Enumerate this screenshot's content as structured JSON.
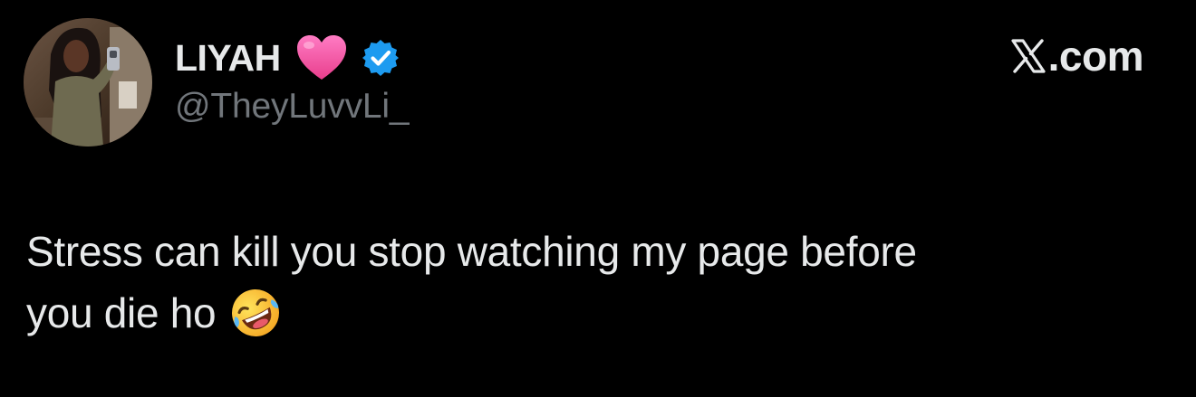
{
  "author": {
    "display_name": "LIYAH",
    "handle": "@TheyLuvvLi_",
    "name_emoji": "pink-heart-icon",
    "verified": true,
    "verified_color": "#1d9bf0"
  },
  "brand": {
    "logo": "x-logo-icon",
    "text": ".com"
  },
  "tweet": {
    "line1": "Stress can kill you stop watching my page before",
    "line2": "you die ho",
    "emoji": "rolling-on-floor-laughing-icon"
  },
  "colors": {
    "background": "#000000",
    "text": "#e7e9ea",
    "secondary_text": "#71767b",
    "heart": "#f25ea5",
    "verified": "#1d9bf0"
  }
}
